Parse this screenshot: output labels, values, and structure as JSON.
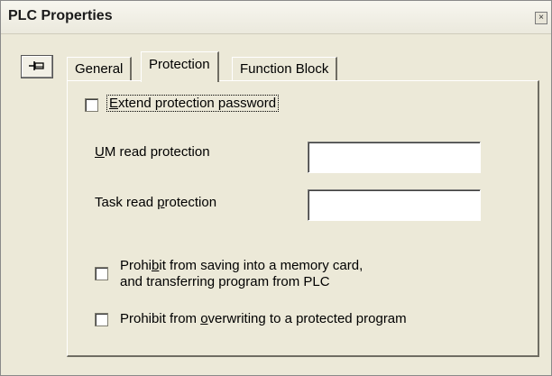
{
  "window": {
    "title": "PLC Properties",
    "close_glyph": "×"
  },
  "tabs": [
    {
      "label": "General",
      "active": false
    },
    {
      "label": "Protection",
      "active": true
    },
    {
      "label": "Function Block",
      "active": false
    }
  ],
  "protection": {
    "extend_password": {
      "pre": "",
      "u": "E",
      "post": "xtend protection password",
      "checked": false
    },
    "um_read": {
      "pre": "",
      "u": "U",
      "post": "M read protection",
      "value": ""
    },
    "task_read": {
      "pre": "Task read ",
      "u": "p",
      "post": "rotection",
      "value": ""
    },
    "prohibit_saving": {
      "line1_pre": "Prohi",
      "line1_u": "b",
      "line1_post": "it from saving into a memory card,",
      "line2": "and transferring program from PLC",
      "checked": false
    },
    "prohibit_overwrite": {
      "pre": "Prohibit from ",
      "u": "o",
      "post": "verwriting to a protected program",
      "checked": false
    }
  },
  "icons": {
    "pin": "pin-icon",
    "close": "close-icon"
  }
}
